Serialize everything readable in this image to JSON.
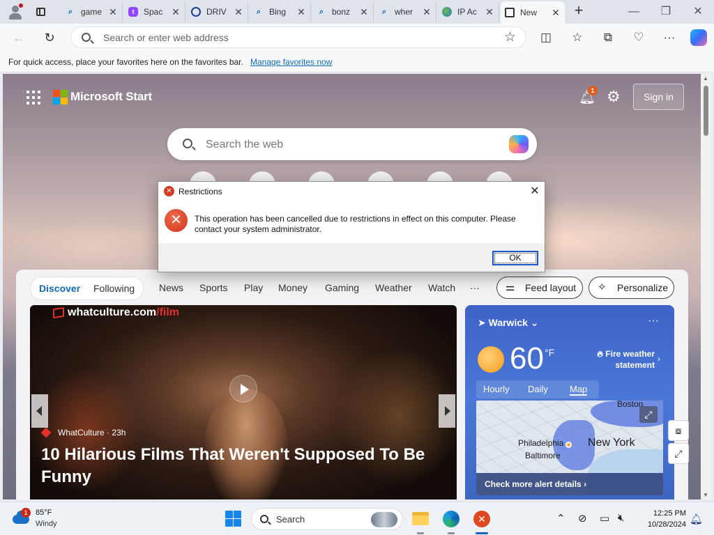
{
  "browser": {
    "tabs": [
      {
        "icon": "search-icon",
        "label": "game"
      },
      {
        "icon": "twitch-icon",
        "label": "Spac"
      },
      {
        "icon": "drive-icon",
        "label": "DRIV"
      },
      {
        "icon": "search-icon",
        "label": "Bing"
      },
      {
        "icon": "search-icon",
        "label": "bonz"
      },
      {
        "icon": "search-icon",
        "label": "wher"
      },
      {
        "icon": "globe-icon",
        "label": "IP Ac"
      },
      {
        "icon": "newtab-icon",
        "label": "New"
      }
    ],
    "address_placeholder": "Search or enter web address",
    "favbar_message": "For quick access, place your favorites here on the favorites bar.",
    "favbar_link": "Manage favorites now"
  },
  "start": {
    "brand": "Microsoft Start",
    "notification_count": "1",
    "signin_label": "Sign in",
    "search_placeholder": "Search the web",
    "segments": [
      "Discover",
      "Following"
    ],
    "categories": [
      "News",
      "Sports",
      "Play",
      "Money",
      "Gaming",
      "Weather",
      "Watch",
      "···"
    ],
    "feed_layout_label": "Feed layout",
    "personalize_label": "Personalize",
    "hero": {
      "logo_main": "whatculture.com",
      "logo_accent": "/film",
      "source": "WhatCulture · 23h",
      "headline": "10 Hilarious Films That Weren't Supposed To Be Funny"
    },
    "weather": {
      "location": "Warwick",
      "temperature": "60",
      "unit": "°F",
      "alert": "Fire weather statement",
      "tabs": [
        "Hourly",
        "Daily",
        "Map"
      ],
      "selected_tab": "Map",
      "map_labels": {
        "boston": "Boston",
        "philadelphia": "Philadelphia",
        "baltimore": "Baltimore",
        "new_york": "New York"
      },
      "more_label": "Check more alert details"
    }
  },
  "dialog": {
    "title": "Restrictions",
    "message": "This operation has been cancelled due to restrictions in effect on this computer. Please contact your system administrator.",
    "ok_label": "OK"
  },
  "taskbar": {
    "weather_badge": "1",
    "temperature": "85°F",
    "condition": "Windy",
    "search_label": "Search",
    "time": "12:25 PM",
    "date": "10/28/2024"
  },
  "colors": {
    "accent": "#0f6cbd",
    "error": "#d33a1f",
    "weather_card": "#4a78d8"
  }
}
